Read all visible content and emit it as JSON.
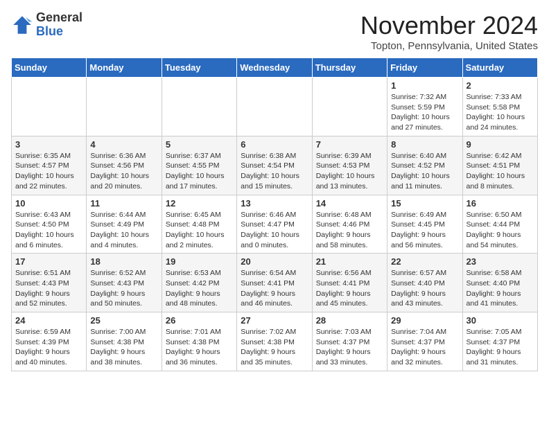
{
  "header": {
    "logo_general": "General",
    "logo_blue": "Blue",
    "month_title": "November 2024",
    "location": "Topton, Pennsylvania, United States"
  },
  "days_of_week": [
    "Sunday",
    "Monday",
    "Tuesday",
    "Wednesday",
    "Thursday",
    "Friday",
    "Saturday"
  ],
  "weeks": [
    [
      {
        "day": "",
        "info": ""
      },
      {
        "day": "",
        "info": ""
      },
      {
        "day": "",
        "info": ""
      },
      {
        "day": "",
        "info": ""
      },
      {
        "day": "",
        "info": ""
      },
      {
        "day": "1",
        "info": "Sunrise: 7:32 AM\nSunset: 5:59 PM\nDaylight: 10 hours and 27 minutes."
      },
      {
        "day": "2",
        "info": "Sunrise: 7:33 AM\nSunset: 5:58 PM\nDaylight: 10 hours and 24 minutes."
      }
    ],
    [
      {
        "day": "3",
        "info": "Sunrise: 6:35 AM\nSunset: 4:57 PM\nDaylight: 10 hours and 22 minutes."
      },
      {
        "day": "4",
        "info": "Sunrise: 6:36 AM\nSunset: 4:56 PM\nDaylight: 10 hours and 20 minutes."
      },
      {
        "day": "5",
        "info": "Sunrise: 6:37 AM\nSunset: 4:55 PM\nDaylight: 10 hours and 17 minutes."
      },
      {
        "day": "6",
        "info": "Sunrise: 6:38 AM\nSunset: 4:54 PM\nDaylight: 10 hours and 15 minutes."
      },
      {
        "day": "7",
        "info": "Sunrise: 6:39 AM\nSunset: 4:53 PM\nDaylight: 10 hours and 13 minutes."
      },
      {
        "day": "8",
        "info": "Sunrise: 6:40 AM\nSunset: 4:52 PM\nDaylight: 10 hours and 11 minutes."
      },
      {
        "day": "9",
        "info": "Sunrise: 6:42 AM\nSunset: 4:51 PM\nDaylight: 10 hours and 8 minutes."
      }
    ],
    [
      {
        "day": "10",
        "info": "Sunrise: 6:43 AM\nSunset: 4:50 PM\nDaylight: 10 hours and 6 minutes."
      },
      {
        "day": "11",
        "info": "Sunrise: 6:44 AM\nSunset: 4:49 PM\nDaylight: 10 hours and 4 minutes."
      },
      {
        "day": "12",
        "info": "Sunrise: 6:45 AM\nSunset: 4:48 PM\nDaylight: 10 hours and 2 minutes."
      },
      {
        "day": "13",
        "info": "Sunrise: 6:46 AM\nSunset: 4:47 PM\nDaylight: 10 hours and 0 minutes."
      },
      {
        "day": "14",
        "info": "Sunrise: 6:48 AM\nSunset: 4:46 PM\nDaylight: 9 hours and 58 minutes."
      },
      {
        "day": "15",
        "info": "Sunrise: 6:49 AM\nSunset: 4:45 PM\nDaylight: 9 hours and 56 minutes."
      },
      {
        "day": "16",
        "info": "Sunrise: 6:50 AM\nSunset: 4:44 PM\nDaylight: 9 hours and 54 minutes."
      }
    ],
    [
      {
        "day": "17",
        "info": "Sunrise: 6:51 AM\nSunset: 4:43 PM\nDaylight: 9 hours and 52 minutes."
      },
      {
        "day": "18",
        "info": "Sunrise: 6:52 AM\nSunset: 4:43 PM\nDaylight: 9 hours and 50 minutes."
      },
      {
        "day": "19",
        "info": "Sunrise: 6:53 AM\nSunset: 4:42 PM\nDaylight: 9 hours and 48 minutes."
      },
      {
        "day": "20",
        "info": "Sunrise: 6:54 AM\nSunset: 4:41 PM\nDaylight: 9 hours and 46 minutes."
      },
      {
        "day": "21",
        "info": "Sunrise: 6:56 AM\nSunset: 4:41 PM\nDaylight: 9 hours and 45 minutes."
      },
      {
        "day": "22",
        "info": "Sunrise: 6:57 AM\nSunset: 4:40 PM\nDaylight: 9 hours and 43 minutes."
      },
      {
        "day": "23",
        "info": "Sunrise: 6:58 AM\nSunset: 4:40 PM\nDaylight: 9 hours and 41 minutes."
      }
    ],
    [
      {
        "day": "24",
        "info": "Sunrise: 6:59 AM\nSunset: 4:39 PM\nDaylight: 9 hours and 40 minutes."
      },
      {
        "day": "25",
        "info": "Sunrise: 7:00 AM\nSunset: 4:38 PM\nDaylight: 9 hours and 38 minutes."
      },
      {
        "day": "26",
        "info": "Sunrise: 7:01 AM\nSunset: 4:38 PM\nDaylight: 9 hours and 36 minutes."
      },
      {
        "day": "27",
        "info": "Sunrise: 7:02 AM\nSunset: 4:38 PM\nDaylight: 9 hours and 35 minutes."
      },
      {
        "day": "28",
        "info": "Sunrise: 7:03 AM\nSunset: 4:37 PM\nDaylight: 9 hours and 33 minutes."
      },
      {
        "day": "29",
        "info": "Sunrise: 7:04 AM\nSunset: 4:37 PM\nDaylight: 9 hours and 32 minutes."
      },
      {
        "day": "30",
        "info": "Sunrise: 7:05 AM\nSunset: 4:37 PM\nDaylight: 9 hours and 31 minutes."
      }
    ]
  ]
}
